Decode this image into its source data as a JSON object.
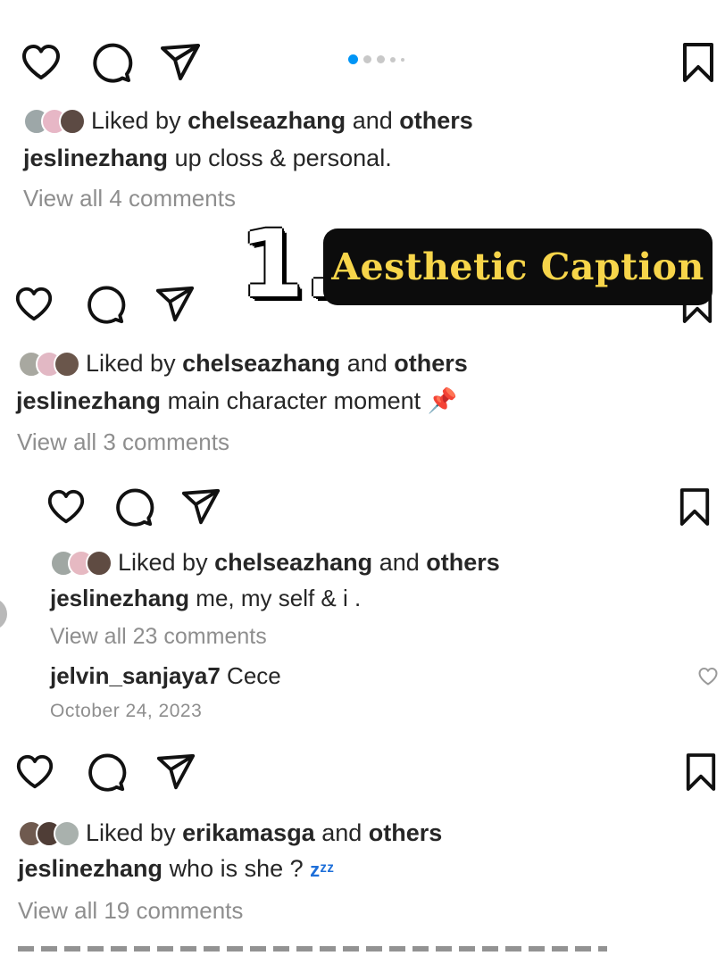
{
  "posts": [
    {
      "liked_by": "Liked by",
      "liker": "chelseazhang",
      "and": "and",
      "others": "others",
      "username": "jeslinezhang",
      "caption": "up closs & personal.",
      "view_all": "View all 4 comments"
    },
    {
      "liked_by": "Liked by",
      "liker": "chelseazhang",
      "and": "and",
      "others": "others",
      "username": "jeslinezhang",
      "caption": "main character moment 📌",
      "view_all": "View all 3 comments"
    },
    {
      "liked_by": "Liked by",
      "liker": "chelseazhang",
      "and": "and",
      "others": "others",
      "username": "jeslinezhang",
      "caption": "me, my self & i .",
      "view_all": "View all 23 comments",
      "comment_user": "jelvin_sanjaya7",
      "comment_text": "Cece",
      "date": "October 24, 2023"
    },
    {
      "liked_by": "Liked by",
      "liker": "erikamasga",
      "and": "and",
      "others": "others",
      "username": "jeslinezhang",
      "caption": "who is she ? ",
      "caption_emoji": "zᶻᶻ",
      "view_all": "View all 19 comments"
    }
  ],
  "overlay": {
    "number": "1.",
    "title": "Aesthetic Caption"
  },
  "colors": {
    "accent": "#0095f6",
    "badge_bg": "#0c0c0c",
    "badge_text": "#f7d54a"
  },
  "icons": [
    "heart-icon",
    "comment-icon",
    "share-icon",
    "bookmark-icon",
    "small-heart-icon"
  ]
}
